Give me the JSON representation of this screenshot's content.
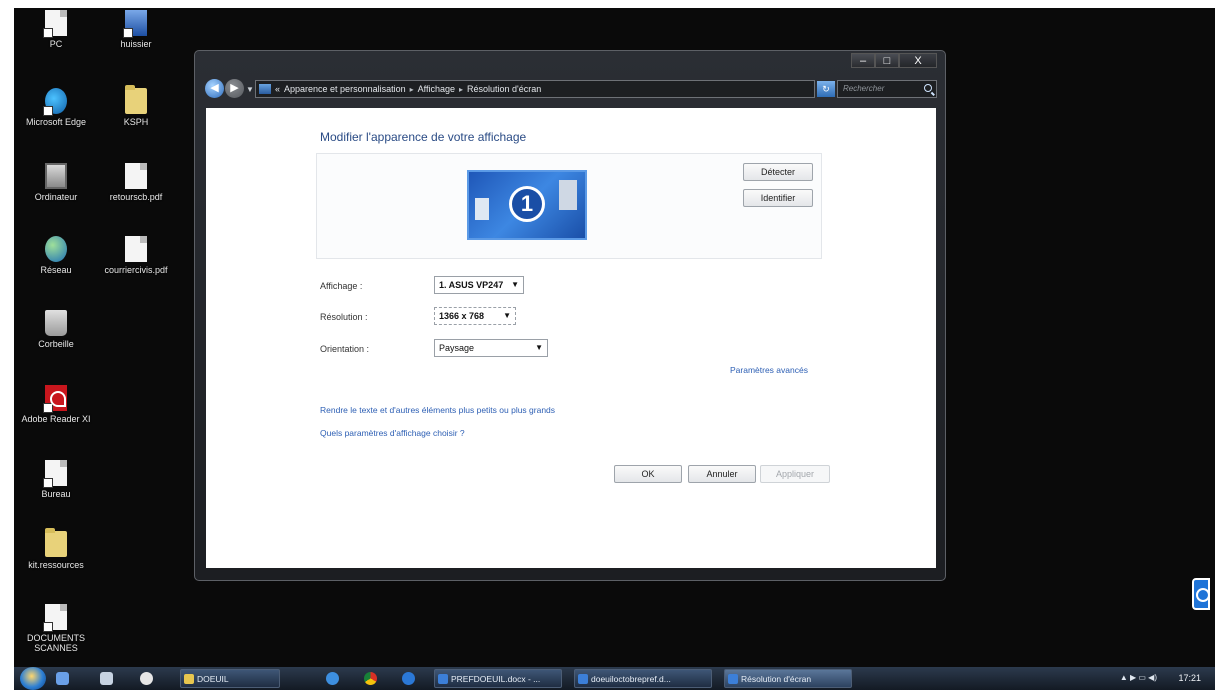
{
  "desktop": {
    "icons": [
      {
        "label": "PC"
      },
      {
        "label": "huissier"
      },
      {
        "label": "Microsoft Edge"
      },
      {
        "label": "KSPH"
      },
      {
        "label": "Ordinateur"
      },
      {
        "label": "retourscb.pdf"
      },
      {
        "label": "Réseau"
      },
      {
        "label": "courriercivis.pdf"
      },
      {
        "label": "Corbeille"
      },
      {
        "label": "Adobe Reader XI"
      },
      {
        "label": "Bureau"
      },
      {
        "label": "kit.ressources"
      },
      {
        "label": "DOCUMENTS SCANNES"
      }
    ]
  },
  "window": {
    "controls": {
      "minimize": "–",
      "maximize": "□",
      "close": "X"
    },
    "nav": {
      "back": "◀",
      "forward": "▶",
      "dropdown": "▼"
    },
    "address": {
      "prefix": "«",
      "crumbs": [
        "Apparence et personnalisation",
        "Affichage",
        "Résolution d'écran"
      ],
      "separator": "▸"
    },
    "refresh": "↻",
    "search_placeholder": "Rechercher"
  },
  "settings": {
    "title": "Modifier l'apparence de votre affichage",
    "monitor_number": "1",
    "detect_button": "Détecter",
    "identify_button": "Identifier",
    "display_label": "Affichage :",
    "display_value": "1. ASUS VP247",
    "resolution_label": "Résolution :",
    "resolution_value": "1366 x 768",
    "orientation_label": "Orientation :",
    "orientation_value": "Paysage",
    "advanced_link": "Paramètres avancés",
    "text_size_link": "Rendre le texte et d'autres éléments plus petits ou plus grands",
    "which_settings_link": "Quels paramètres d'affichage choisir ?",
    "ok_button": "OK",
    "cancel_button": "Annuler",
    "apply_button": "Appliquer"
  },
  "taskbar": {
    "items": [
      {
        "label": "DOEUIL"
      },
      {
        "label": "PREFDOEUIL.docx - ..."
      },
      {
        "label": "doeuiloctobrepref.d..."
      },
      {
        "label": "Résolution d'écran"
      }
    ],
    "tray": "▲  ▶  ▭  ◀)",
    "clock": "17:21"
  }
}
